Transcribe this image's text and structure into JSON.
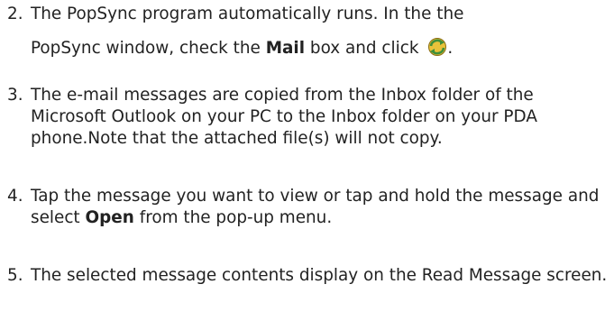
{
  "steps": [
    {
      "number": "2.",
      "line1": "The PopSync program automatically runs. In the the",
      "line2_before": "PopSync window, check the ",
      "line2_bold": "Mail",
      "line2_mid": " box and click ",
      "line2_after": ".",
      "icon": "sync-icon"
    },
    {
      "number": "3.",
      "text": "The e-mail messages are copied from the Inbox folder of the Microsoft Outlook on your PC to the Inbox folder on your PDA phone.Note that the attached file(s) will not copy."
    },
    {
      "number": "4.",
      "text_before": "Tap the message you want to view or tap and hold the message and select ",
      "text_bold": "Open",
      "text_after": " from the pop-up menu."
    },
    {
      "number": "5.",
      "text": "The selected message contents display on the Read Message screen."
    }
  ],
  "colors": {
    "text": "#222222",
    "icon_yellow": "#e8c23a",
    "icon_green": "#3f8f3a"
  }
}
